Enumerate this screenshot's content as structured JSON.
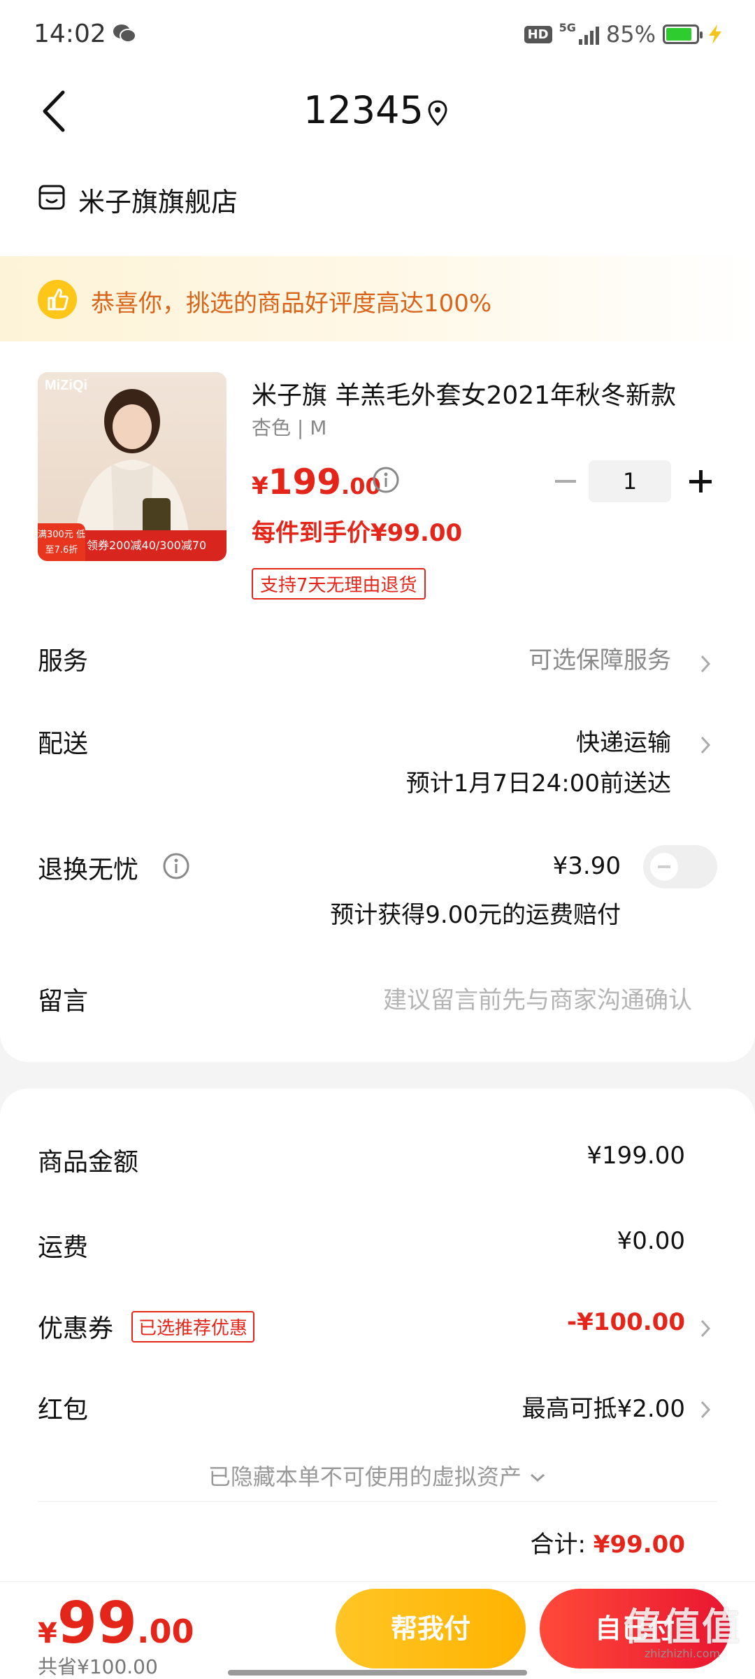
{
  "status_bar": {
    "time": "14:02",
    "network": "5G",
    "hd": "HD",
    "battery": "85%",
    "battery_level": 0.85
  },
  "header": {
    "title": "12345"
  },
  "shop": {
    "name": "米子旗旗舰店"
  },
  "banner": {
    "text": "恭喜你，挑选的商品好评度高达100%"
  },
  "product": {
    "image_brand": "MiZiQi",
    "image_promo_badge": "满300元 低至7.6折",
    "image_promo": "领券200减40/300减70",
    "title": "米子旗 羊羔毛外套女2021年秋冬新款",
    "spec": "杏色 | M",
    "price_currency": "¥",
    "price_int": "199",
    "price_dec": ".00",
    "quantity": "1",
    "final_price": "每件到手价¥99.00",
    "return_tag": "支持7天无理由退货"
  },
  "rows": {
    "service": {
      "label": "服务",
      "value": "可选保障服务"
    },
    "delivery": {
      "label": "配送",
      "value": "快递运输",
      "eta": "预计1月7日24:00前送达"
    },
    "worry_free": {
      "label": "退换无忧",
      "price": "¥3.90",
      "note": "预计获得9.00元的运费赔付",
      "enabled": false
    },
    "message": {
      "label": "留言",
      "placeholder": "建议留言前先与商家沟通确认"
    }
  },
  "summary": {
    "goods": {
      "label": "商品金额",
      "value": "¥199.00"
    },
    "shipping": {
      "label": "运费",
      "value": "¥0.00"
    },
    "coupon": {
      "label": "优惠券",
      "tag": "已选推荐优惠",
      "value": "-¥100.00"
    },
    "redpacket": {
      "label": "红包",
      "value": "最高可抵¥2.00"
    },
    "hidden_assets": "已隐藏本单不可使用的虚拟资产",
    "total_label": "合计:",
    "total_value": "¥99.00"
  },
  "bottom": {
    "price_currency": "¥",
    "price_int": "99",
    "price_dec": ".00",
    "saved": "共省¥100.00",
    "help_pay": "帮我付",
    "self_pay": "自己付",
    "watermark": "值值值",
    "watermark_url": "zhizhizhi.com"
  },
  "colors": {
    "accent_red": "#e4261a",
    "help_button": "#ffb300",
    "banner_text": "#d9641a",
    "battery_green": "#2ecc2e"
  }
}
